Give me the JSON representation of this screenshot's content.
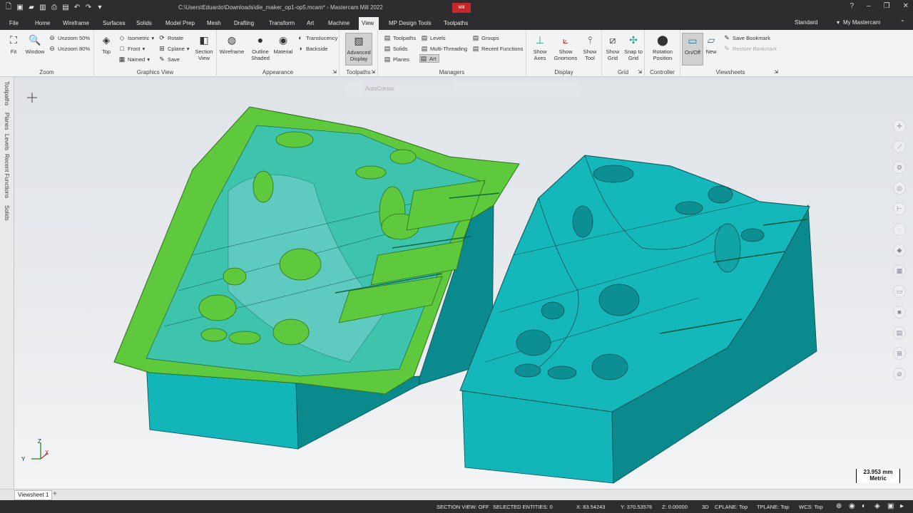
{
  "window": {
    "title": "C:\\Users\\Eduardo\\Downloads\\die_maker_op1-op5.mcam* - Mastercam Mill 2022",
    "badge": "Mill"
  },
  "quick_access": [
    "new-icon",
    "save-icon",
    "open-icon",
    "save-as-icon",
    "print-icon",
    "print-preview-icon",
    "undo-icon",
    "redo-icon",
    "customize-icon"
  ],
  "menu": {
    "tabs": [
      "File",
      "Home",
      "Wireframe",
      "Surfaces",
      "Solids",
      "Model Prep",
      "Mesh",
      "Drafting",
      "Transform",
      "Art",
      "Machine",
      "View",
      "MP Design Tools",
      "Toolpaths"
    ],
    "active": "View",
    "standard": "Standard",
    "my_mastercam": "My Mastercam"
  },
  "ribbon": {
    "zoom": {
      "label": "Zoom",
      "fit": "Fit",
      "window": "Window",
      "unzoom50": "Unzoom 50%",
      "unzoom80": "Unzoom 80%"
    },
    "graphics_view": {
      "label": "Graphics View",
      "top": "Top",
      "isometric": "Isometric",
      "front": "Front",
      "named": "Named",
      "rotate": "Rotate",
      "cplane": "Cplane",
      "save": "Save",
      "section_view": "Section View"
    },
    "appearance": {
      "label": "Appearance",
      "wireframe": "Wireframe",
      "outline_shaded": "Outline Shaded",
      "material": "Material",
      "translucency": "Translucency",
      "backside": "Backside"
    },
    "toolpaths": {
      "label": "Toolpaths",
      "advanced_display": "Advanced Display"
    },
    "managers": {
      "label": "Managers",
      "toolpaths": "Toolpaths",
      "solids": "Solids",
      "planes": "Planes",
      "levels": "Levels",
      "multi_threading": "Multi-Threading",
      "art": "Art",
      "groups": "Groups",
      "recent_functions": "Recent Functions"
    },
    "display": {
      "label": "Display",
      "show_axes": "Show Axes",
      "show_gnomons": "Show Gnomons",
      "show_tool": "Show Tool"
    },
    "grid": {
      "label": "Grid",
      "show_grid": "Show Grid",
      "snap_to_grid": "Snap to Grid"
    },
    "controller": {
      "label": "Controller",
      "rotation_position": "Rotation Position"
    },
    "viewsheets": {
      "label": "Viewsheets",
      "on_off": "On/Off",
      "new": "New",
      "save_bookmark": "Save Bookmark",
      "restore_bookmark": "Restore Bookmark"
    }
  },
  "left_panel": [
    "Toolpaths",
    "Planes",
    "Levels",
    "Recent Functions",
    "Solids"
  ],
  "viewport": {
    "autocursor": "AutoCursor",
    "scale_value": "23.953 mm",
    "scale_unit": "Metric",
    "gnomon": {
      "z": "Z",
      "y": "Y",
      "x": "X"
    },
    "colors": {
      "part": "#12b5b8",
      "part_dark": "#0b8a8e",
      "selected": "#5fc93d",
      "background": "#e6e9ec"
    }
  },
  "viewsheet_tab": "Viewsheet 1",
  "status": {
    "section_view": "SECTION VIEW: OFF",
    "selected": "SELECTED ENTITIES: 0",
    "x": "X:  83.54243",
    "y": "Y:  370.53576",
    "z": "Z:  0.00000",
    "mode": "3D",
    "cplane": "CPLANE: Top",
    "tplane": "TPLANE: Top",
    "wcs": "WCS: Top"
  }
}
